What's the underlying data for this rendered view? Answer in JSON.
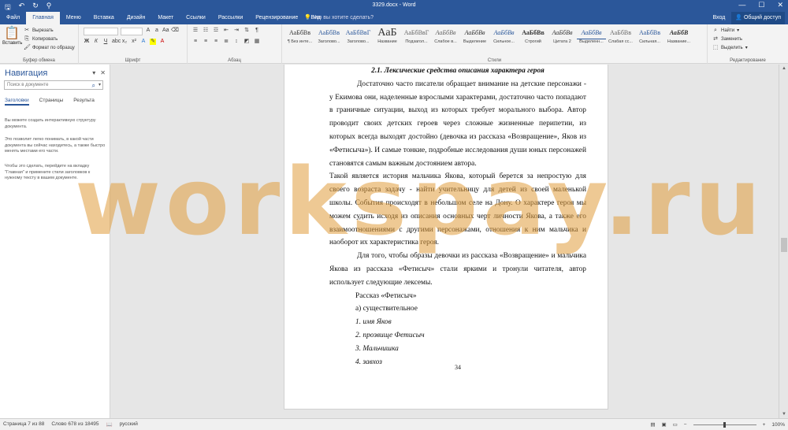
{
  "titlebar": {
    "title": "3329.docx - Word",
    "qat_save": "🖫",
    "qat_undo": "↶",
    "qat_redo": "↻",
    "qat_more": "⚲",
    "min": "—",
    "max": "☐",
    "close": "✕"
  },
  "tabs": {
    "file": "Файл",
    "items": [
      "Главная",
      "Меню",
      "Вставка",
      "Дизайн",
      "Макет",
      "Ссылки",
      "Рассылки",
      "Рецензирование",
      "Вид"
    ],
    "tellme": "Что вы хотите сделать?",
    "signin": "Вход",
    "share": "Общий доступ"
  },
  "ribbon": {
    "clipboard": {
      "paste": "Вставить",
      "cut": "Вырезать",
      "copy": "Копировать",
      "format_painter": "Формат по образцу",
      "label": "Буфер обмена"
    },
    "font": {
      "label": "Шрифт"
    },
    "paragraph": {
      "label": "Абзац"
    },
    "styles": {
      "label": "Стили",
      "items": [
        {
          "sample": "АаБбВв",
          "name": "¶ Без инте..."
        },
        {
          "sample": "АаБбВв",
          "name": "Заголово..."
        },
        {
          "sample": "АаБбВвГ",
          "name": "Заголово..."
        },
        {
          "sample": "АаБ",
          "name": "Название"
        },
        {
          "sample": "АаБбВвГ",
          "name": "Подзагол..."
        },
        {
          "sample": "АаБбВв",
          "name": "Слабое в..."
        },
        {
          "sample": "АаБбВв",
          "name": "Выделение"
        },
        {
          "sample": "АаБбВв",
          "name": "Сильное..."
        },
        {
          "sample": "АаБбВв",
          "name": "Строгий"
        },
        {
          "sample": "АаБбВв",
          "name": "Цитата 2"
        },
        {
          "sample": "АаБбВв",
          "name": "Выделенн..."
        },
        {
          "sample": "АаБбВв",
          "name": "Слабая сс..."
        },
        {
          "sample": "АаБбВв",
          "name": "Сильная..."
        },
        {
          "sample": "АаБбВ",
          "name": "Название..."
        }
      ]
    },
    "editing": {
      "label": "Редактирование",
      "find": "Найти",
      "replace": "Заменить",
      "select": "Выделить"
    }
  },
  "nav": {
    "title": "Навигация",
    "search_placeholder": "Поиск в документе",
    "tabs": [
      "Заголовки",
      "Страницы",
      "Результа"
    ],
    "msg1": "Вы можете создать интерактивную структуру документа.",
    "msg2": "Это позволит легко понимать, в какой части документа вы сейчас находитесь, а также быстро менять местами его части.",
    "msg3": "Чтобы это сделать, перейдите на вкладку \"Главная\" и примените стили заголовков к нужному тексту в вашем документе."
  },
  "document": {
    "heading": "2.1. Лексические средства описания характера героя",
    "p1": "Достаточно часто писатели обращает внимание на детские персонажи - у Екимова они, наделенные взрослыми характерами, достаточно часто попадают в граничные ситуации, выход из которых требует морального выбора. Автор проводит своих детских героев через сложные жизненные перипетии, из которых всегда выходят достойно (девочка из рассказа «Возвращение», Яков из «Фетисыча»). И самые тонкие, подробные исследования души юных персонажей становятся самым важным достоянием автора.",
    "p2": "Такой является история мальчика Якова, который берется за непростую для своего возраста задачу - найти учительницу для детей из своей маленькой школы. События происходят в небольшом селе на Дону. О характере героя мы можем судить исходя из описания основных черт личности Якова, а также его взаимоотношениями с другими персонажами, отношения к ним мальчика и наоборот их характеристика героя.",
    "p3": "Для того, чтобы образы девочки из рассказа «Возвращение» и мальчика Якова из рассказа «Фетисыч» стали яркими и тронули читателя, автор использует следующие лексемы.",
    "story": "Рассказ «Фетисыч»",
    "noun": "а) существительное",
    "list": [
      "1.  имя Яков",
      "2.  прозвище Фетисыч",
      "3.  Мальчишка",
      "4.  завхоз"
    ],
    "page_number": "34"
  },
  "status": {
    "page": "Страница 7 из 88",
    "words": "Слово 678 из 18495",
    "lang": "русский",
    "zoom": "100%"
  },
  "watermark": "workspay.ru"
}
